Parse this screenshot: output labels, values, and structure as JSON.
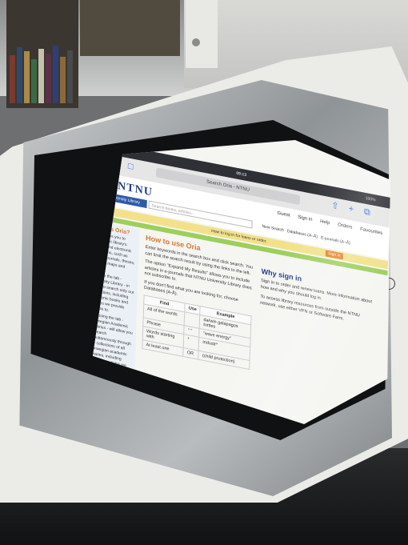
{
  "browser": {
    "status_time": "09:13",
    "status_battery": "100%",
    "url": "Search Oria - NTNU"
  },
  "site": {
    "logo": "NTNU",
    "nav": [
      "Guest",
      "Sign in",
      "Help",
      "Orders",
      "Favourites"
    ],
    "library_label": "University Library",
    "search_placeholder": "Search books, articles...",
    "search_links": [
      "New Search",
      "Databases (A–Å)",
      "E-journals (A–Å)"
    ],
    "notice": "How to log in for loans or order.",
    "signin_button": "Sign in"
  },
  "left": {
    "heading": "What is Oria?",
    "paragraphs": [
      "Oria allows you to search the library's printed and electronic collections, such as books, journals, theses, articles, maps and more.",
      "Choose the tab - University Library - in order to search only our collections, including electronic books and articles we provide access to.",
      "Choosing the tab - Norwegian Academic Libraries - will allow you to search simultaneously through the collections of all Norwegian academic libraries, including electronic articles we provide access to."
    ]
  },
  "middle": {
    "heading": "How to use Oria",
    "paragraphs": [
      "Enter keywords in the search box and click search. You can limit the search result by using the links to the left.",
      "The option \"Expand My Results\" allows you to include articles in e-journals that NTNU University Library does not subscribe to.",
      "If you don't find what you are looking for, choose Databases (A-Å)."
    ],
    "table": {
      "headers": [
        "Find",
        "Use",
        "Example"
      ],
      "rows": [
        [
          "All of the words",
          "",
          "darwin galapagos turtles"
        ],
        [
          "Phrase",
          "\" \"",
          "\"wave energy\""
        ],
        [
          "Words starting with",
          "*",
          "industr*"
        ],
        [
          "At least one",
          "OR",
          "(child protection)"
        ]
      ]
    }
  },
  "right": {
    "heading": "Why sign in",
    "paragraphs": [
      "Sign in to order and renew loans. More information about how and why you should log in.",
      "To access library resources from outside the NTNU network, use either VPN or Software Farm."
    ]
  }
}
